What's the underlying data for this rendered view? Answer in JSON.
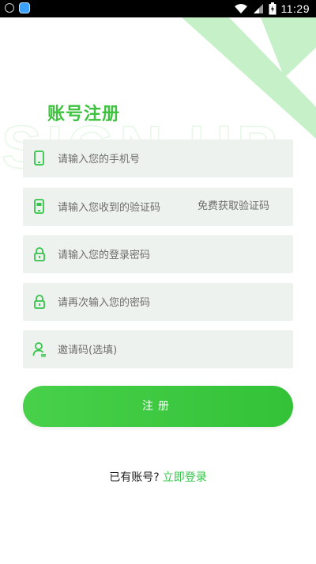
{
  "status_bar": {
    "time": "11:29"
  },
  "colors": {
    "brand_green": "#3fc23f",
    "input_bg": "#eef2ee"
  },
  "page": {
    "title": "账号注册",
    "watermark_text": "SIGN UP"
  },
  "form": {
    "phone": {
      "placeholder": "请输入您的手机号",
      "value": "",
      "icon": "phone-icon"
    },
    "verification_code": {
      "placeholder": "请输入您收到的验证码",
      "value": "",
      "icon": "sms-phone-icon",
      "action_label": "免费获取验证码"
    },
    "password": {
      "placeholder": "请输入您的登录密码",
      "value": "",
      "icon": "lock-icon"
    },
    "confirm_password": {
      "placeholder": "请再次输入您的密码",
      "value": "",
      "icon": "lock-icon"
    },
    "invite_code": {
      "placeholder": "邀请码(选填)",
      "value": "",
      "icon": "user-icon"
    }
  },
  "register_button": {
    "label": "注册"
  },
  "footer": {
    "prompt": "已有账号?",
    "login_link": "立即登录"
  }
}
